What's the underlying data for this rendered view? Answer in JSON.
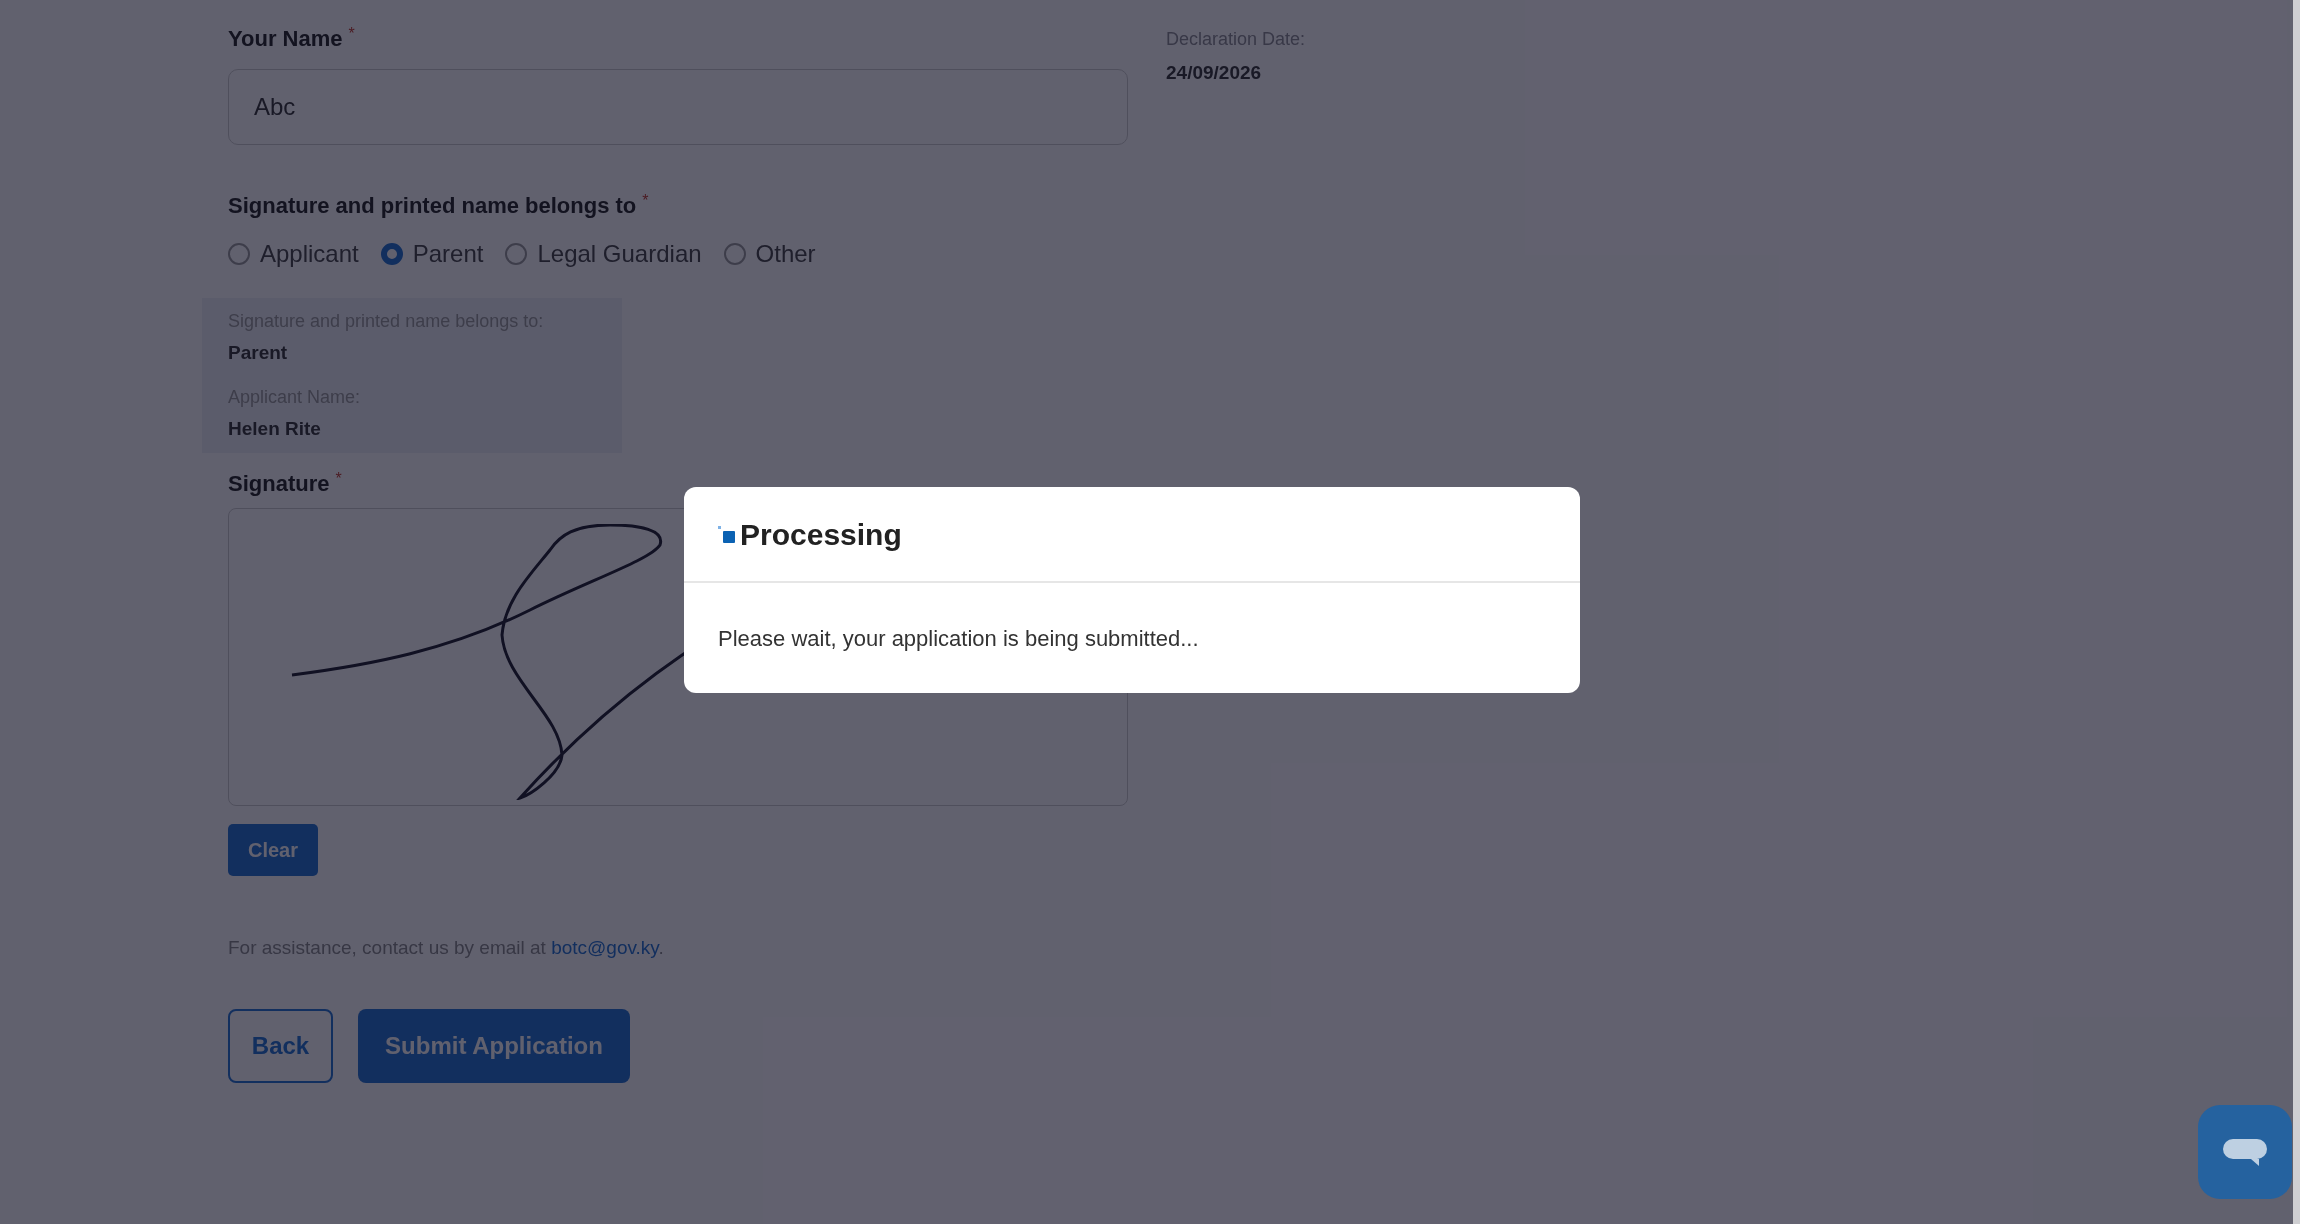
{
  "declaration": {
    "label": "Declaration Date:",
    "value": "24/09/2026"
  },
  "name_field": {
    "label": "Your Name",
    "required_mark": "*",
    "value": "Abc"
  },
  "belongs_to": {
    "label": "Signature and printed name belongs to",
    "required_mark": "*",
    "options": [
      {
        "label": "Applicant",
        "selected": false
      },
      {
        "label": "Parent",
        "selected": true
      },
      {
        "label": "Legal Guardian",
        "selected": false
      },
      {
        "label": "Other",
        "selected": false
      }
    ]
  },
  "summary": [
    {
      "label": "Signature and printed name belongs to:",
      "value": "Parent"
    },
    {
      "label": "Applicant Name:",
      "value": "Helen Rite"
    }
  ],
  "signature": {
    "label": "Signature",
    "required_mark": "*",
    "clear_button": "Clear"
  },
  "assistance": {
    "text": "For assistance, contact us by email at ",
    "email": "botc@gov.ky",
    "end": "."
  },
  "buttons": {
    "back": "Back",
    "submit": "Submit Application"
  },
  "modal": {
    "title": "Processing",
    "message": "Please wait, your application is being submitted..."
  }
}
